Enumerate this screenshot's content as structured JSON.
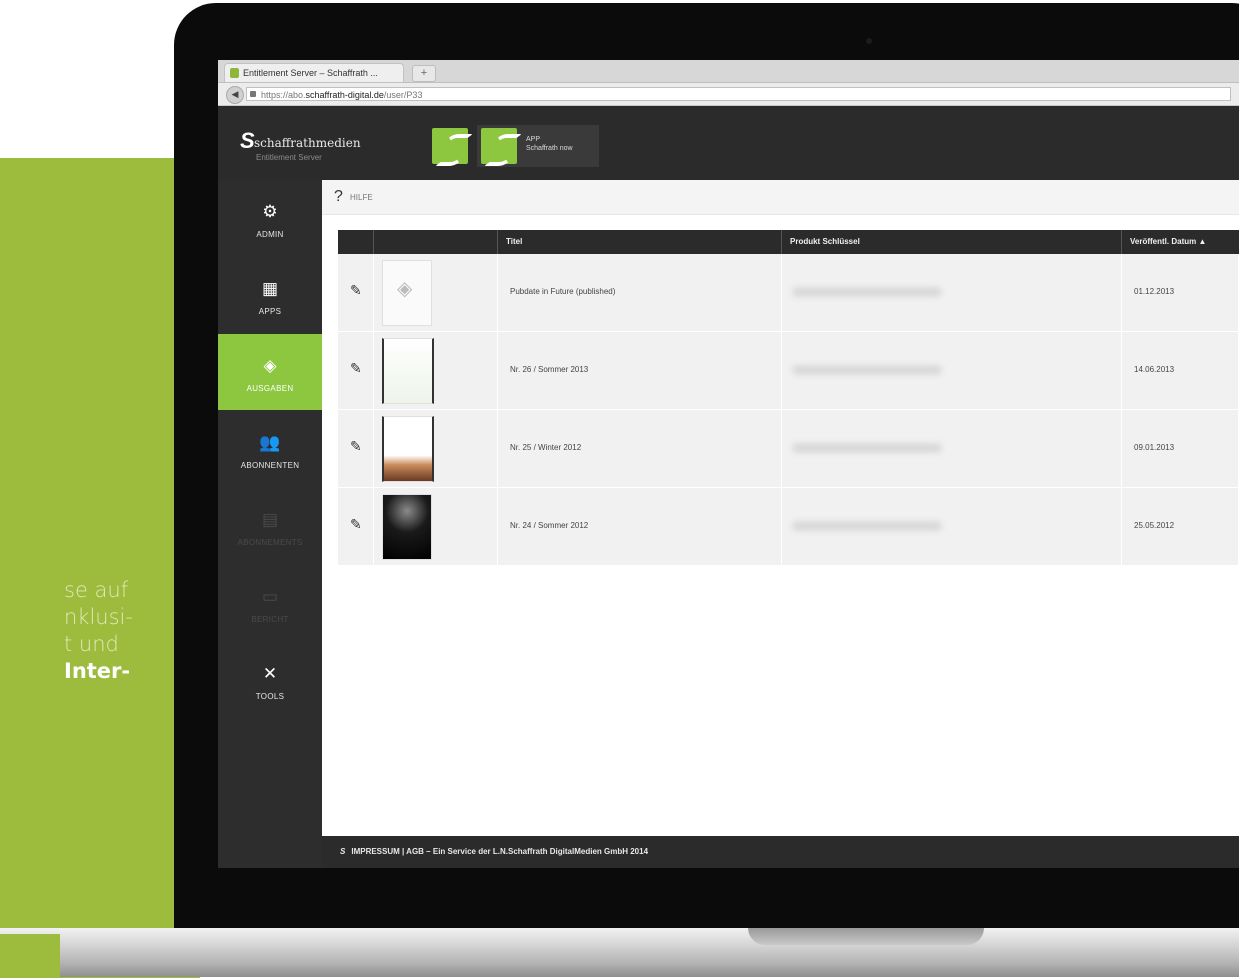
{
  "promo": {
    "lines": [
      "se auf",
      "nklusi-",
      "t und"
    ],
    "strong_line": "Inter-"
  },
  "browser": {
    "tab_title": "Entitlement Server – Schaffrath ...",
    "new_tab": "+",
    "url_prefix": "https://abo.",
    "url_host": "schaffrath-digital.de",
    "url_path": "/user/P33",
    "back": "◀"
  },
  "header": {
    "logo_mark": "S",
    "logo_text": "schaffrathmedien",
    "logo_sub": "Entitlement Server",
    "app_label_line1": "APP",
    "app_label_line2": "Schaffrath now"
  },
  "sidebar": {
    "items": [
      {
        "icon": "⚙",
        "label": "ADMIN"
      },
      {
        "icon": "▦",
        "label": "APPS"
      },
      {
        "icon": "◈",
        "label": "AUSGABEN"
      },
      {
        "icon": "👥",
        "label": "ABONNENTEN"
      },
      {
        "icon": "▤",
        "label": "ABONNEMENTS"
      },
      {
        "icon": "▭",
        "label": "BERICHT"
      },
      {
        "icon": "✕",
        "label": "TOOLS"
      }
    ]
  },
  "help": {
    "icon": "?",
    "label": "HILFE"
  },
  "table": {
    "headers": [
      "",
      "",
      "Titel",
      "Produkt Schlüssel",
      "Veröffentl. Datum ▲"
    ],
    "rows": [
      {
        "title": "Pubdate in Future (published)",
        "date": "01.12.2013"
      },
      {
        "title": "Nr. 26 / Sommer 2013",
        "date": "14.06.2013"
      },
      {
        "title": "Nr. 25 / Winter 2012",
        "date": "09.01.2013"
      },
      {
        "title": "Nr. 24 / Sommer 2012",
        "date": "25.05.2012"
      }
    ]
  },
  "footer": {
    "mark": "S",
    "text": "IMPRESSUM | AGB – Ein Service der L.N.Schaffrath DigitalMedien GmbH 2014"
  }
}
